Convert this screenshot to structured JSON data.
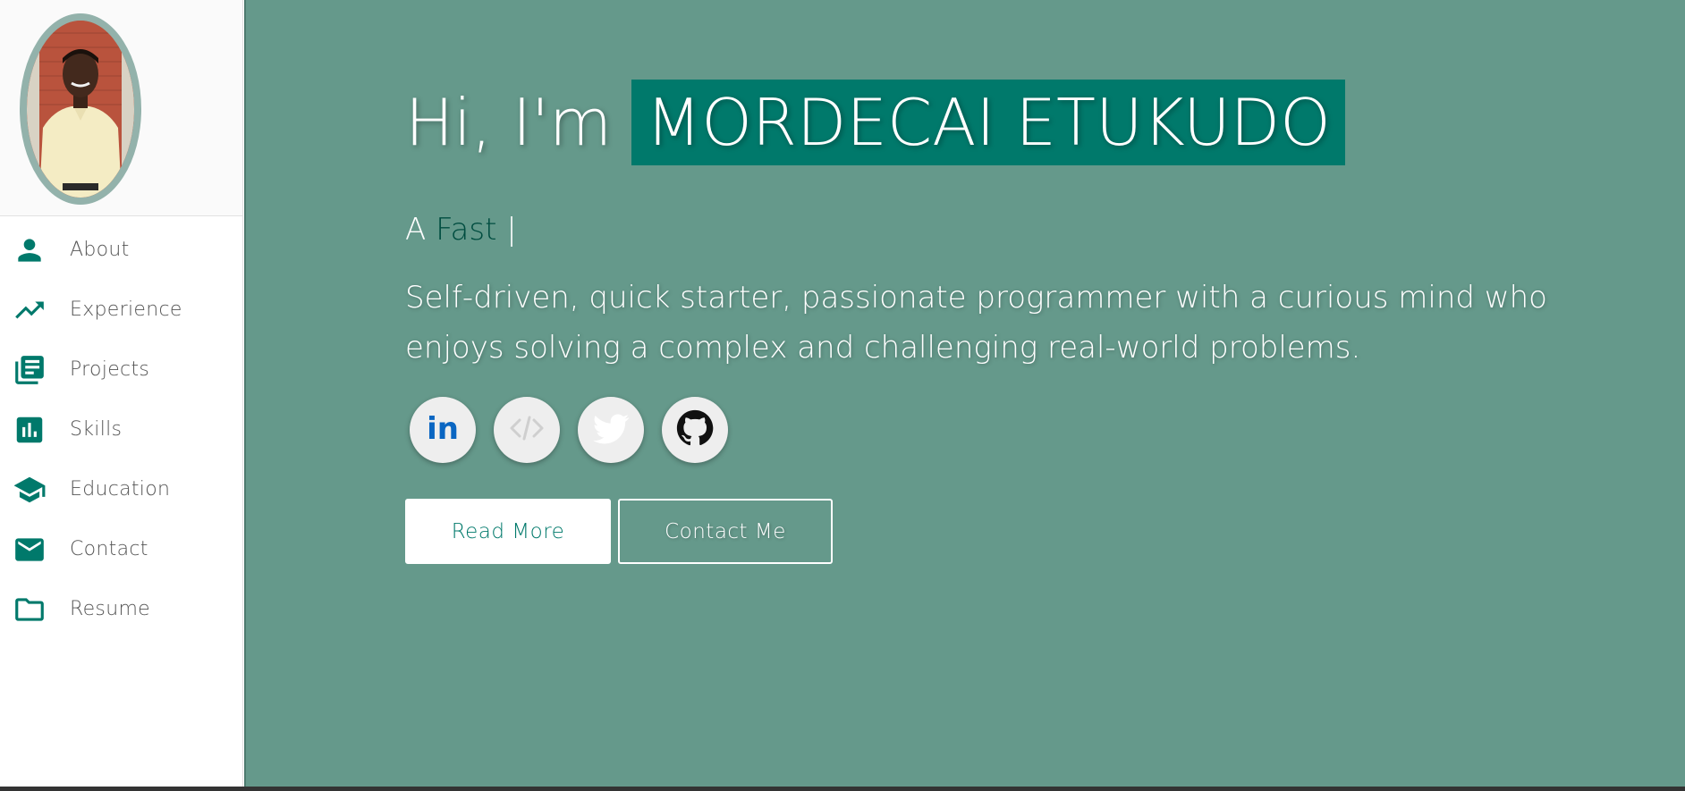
{
  "sidebar": {
    "avatar_alt": "profile photo",
    "items": [
      {
        "label": "About",
        "icon": "person-icon"
      },
      {
        "label": "Experience",
        "icon": "trending-up-icon"
      },
      {
        "label": "Projects",
        "icon": "library-books-icon"
      },
      {
        "label": "Skills",
        "icon": "bar-chart-icon"
      },
      {
        "label": "Education",
        "icon": "school-icon"
      },
      {
        "label": "Contact",
        "icon": "mail-icon"
      },
      {
        "label": "Resume",
        "icon": "folder-icon"
      }
    ]
  },
  "hero": {
    "greeting_prefix": "Hi, I'm",
    "name": "MORDECAI ETUKUDO",
    "tagline_prefix": "A",
    "tagline_word": "Fast",
    "tagline_cursor": "|",
    "intro": "Self-driven, quick starter, passionate programmer with a curious mind who enjoys solving a complex and challenging real-world problems.",
    "socials": [
      {
        "name": "linkedin",
        "icon": "linkedin-icon"
      },
      {
        "name": "code",
        "icon": "code-icon"
      },
      {
        "name": "twitter",
        "icon": "twitter-icon"
      },
      {
        "name": "github",
        "icon": "github-icon"
      }
    ],
    "read_more_label": "Read More",
    "contact_label": "Contact Me"
  },
  "colors": {
    "accent": "#00796b",
    "hero_bg": "#65998b",
    "tagline_word": "#004d40",
    "avatar_border": "#93b2ab"
  }
}
